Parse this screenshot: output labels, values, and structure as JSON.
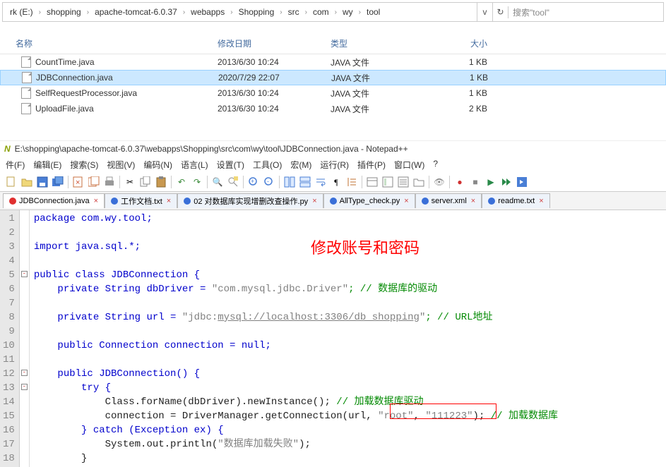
{
  "explorer": {
    "breadcrumbs": [
      "rk (E:)",
      "shopping",
      "apache-tomcat-6.0.37",
      "webapps",
      "Shopping",
      "src",
      "com",
      "wy",
      "tool"
    ],
    "search_placeholder": "搜索\"tool\"",
    "headers": {
      "name": "名称",
      "date": "修改日期",
      "type": "类型",
      "size": "大小"
    },
    "rows": [
      {
        "name": "CountTime.java",
        "date": "2013/6/30 10:24",
        "type": "JAVA 文件",
        "size": "1 KB",
        "sel": false
      },
      {
        "name": "JDBConnection.java",
        "date": "2020/7/29 22:07",
        "type": "JAVA 文件",
        "size": "1 KB",
        "sel": true
      },
      {
        "name": "SelfRequestProcessor.java",
        "date": "2013/6/30 10:24",
        "type": "JAVA 文件",
        "size": "1 KB",
        "sel": false
      },
      {
        "name": "UploadFile.java",
        "date": "2013/6/30 10:24",
        "type": "JAVA 文件",
        "size": "2 KB",
        "sel": false
      }
    ]
  },
  "npp": {
    "title": "E:\\shopping\\apache-tomcat-6.0.37\\webapps\\Shopping\\src\\com\\wy\\tool\\JDBConnection.java - Notepad++",
    "menus": [
      "件(F)",
      "编辑(E)",
      "搜索(S)",
      "视图(V)",
      "编码(N)",
      "语言(L)",
      "设置(T)",
      "工具(O)",
      "宏(M)",
      "运行(R)",
      "插件(P)",
      "窗口(W)",
      "?"
    ],
    "tabs": [
      {
        "label": "JDBConnection.java",
        "dirty": "red",
        "active": true
      },
      {
        "label": "工作文档.txt",
        "dirty": "blue",
        "active": false
      },
      {
        "label": "02 对数据库实现增删改查操作.py",
        "dirty": "blue",
        "active": false
      },
      {
        "label": "AllType_check.py",
        "dirty": "blue",
        "active": false
      },
      {
        "label": "server.xml",
        "dirty": "blue",
        "active": false
      },
      {
        "label": "readme.txt",
        "dirty": "blue",
        "active": false
      }
    ],
    "annotation": "修改账号和密码",
    "code": {
      "l1": "package com.wy.tool;",
      "l3": "import java.sql.*;",
      "l5": "public class JDBConnection {",
      "l6a": "    private String dbDriver = ",
      "l6b": "\"com.mysql.jdbc.Driver\"",
      "l6c": "; // 数据库的驱动",
      "l8a": "    private String url = ",
      "l8b": "\"jdbc:",
      "l8u": "mysql://localhost:3306/db_shopping",
      "l8c": "\"",
      "l8d": "; // URL地址",
      "l10": "    public Connection connection = null;",
      "l12": "    public JDBConnection() {",
      "l13": "        try {",
      "l14a": "            Class.forName(dbDriver).newInstance(); ",
      "l14b": "// 加载数据库驱动",
      "l15a": "            connection = DriverManager.getConnection(url, ",
      "l15b": "\"root\"",
      "l15c": ", ",
      "l15d": "\"111223\"",
      "l15e": "); ",
      "l15f": "// 加载数据库",
      "l16": "        } catch (Exception ex) {",
      "l17a": "            System.out.println(",
      "l17b": "\"数据库加载失败\"",
      "l17c": ");",
      "l18": "        }"
    }
  }
}
